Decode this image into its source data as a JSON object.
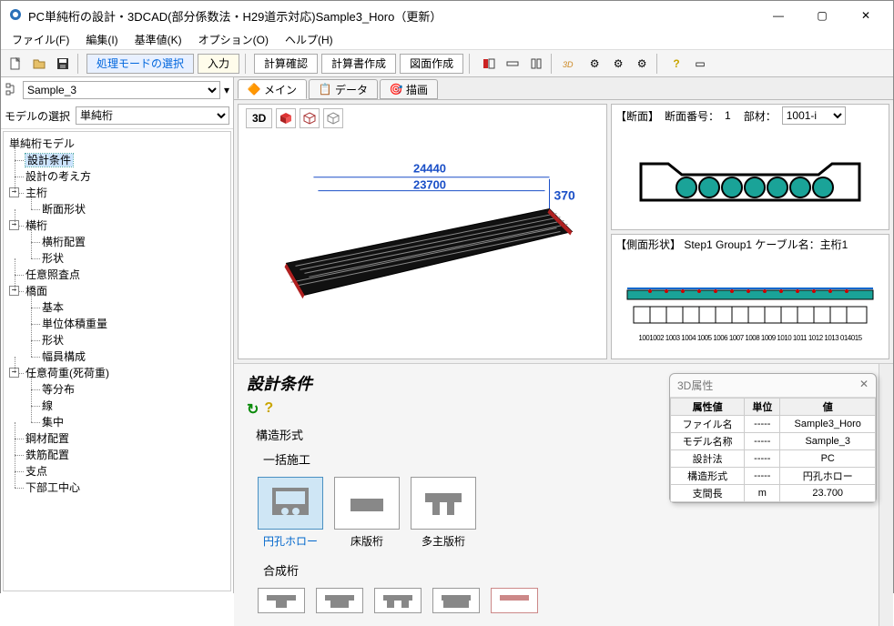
{
  "window": {
    "title": "PC単純桁の設計・3DCAD(部分係数法・H29道示対応)Sample3_Horo（更新）"
  },
  "menu": {
    "file": "ファイル(F)",
    "edit": "編集(I)",
    "basic": "基準値(K)",
    "option": "オプション(O)",
    "help": "ヘルプ(H)"
  },
  "toolbar": {
    "mode_select": "処理モードの選択",
    "input": "入力",
    "calc_check": "計算確認",
    "report": "計算書作成",
    "drawing": "図面作成"
  },
  "left": {
    "project": "Sample_3",
    "model_label": "モデルの選択",
    "model_value": "単純桁",
    "tree": {
      "root": "単純桁モデル",
      "n1": "設計条件",
      "n2": "設計の考え方",
      "n3": "主桁",
      "n3a": "断面形状",
      "n4": "横桁",
      "n4a": "横桁配置",
      "n4b": "形状",
      "n5": "任意照査点",
      "n6": "橋面",
      "n6a": "基本",
      "n6b": "単位体積重量",
      "n6c": "形状",
      "n6d": "幅員構成",
      "n7": "任意荷重(死荷重)",
      "n7a": "等分布",
      "n7b": "線",
      "n7c": "集中",
      "n8": "鋼材配置",
      "n9": "鉄筋配置",
      "n10": "支点",
      "n11": "下部工中心"
    }
  },
  "tabs": {
    "main": "メイン",
    "data": "データ",
    "draw": "描画"
  },
  "view3d": {
    "btn3d": "3D",
    "dim1": "24440",
    "dim2": "23700",
    "dim3": "370"
  },
  "section": {
    "hdr_prefix": "【断面】",
    "hdr_no_label": "断面番号：",
    "hdr_no": "1",
    "member_label": "部材：",
    "member": "1001-i"
  },
  "side_shape": {
    "hdr": "【側面形状】 Step1 Group1 ケーブル名：主桁1",
    "ticks": "1001002 1003 1004 1005 1006 1007 1008 1009 1010 1011 1012 1013 014015"
  },
  "design": {
    "title": "設計条件",
    "kouzou": "構造形式",
    "ikkatsu": "一括施工",
    "opt1": "円孔ホロー",
    "opt2": "床版桁",
    "opt3": "多主版桁",
    "gousei": "合成桁"
  },
  "attr_panel": {
    "title": "3D属性",
    "h1": "属性値",
    "h2": "単位",
    "h3": "値",
    "r1k": "ファイル名",
    "r1u": "-----",
    "r1v": "Sample3_Horo",
    "r2k": "モデル名称",
    "r2u": "-----",
    "r2v": "Sample_3",
    "r3k": "設計法",
    "r3u": "-----",
    "r3v": "PC",
    "r4k": "構造形式",
    "r4u": "-----",
    "r4v": "円孔ホロー",
    "r5k": "支間長",
    "r5u": "m",
    "r5v": "23.700"
  }
}
